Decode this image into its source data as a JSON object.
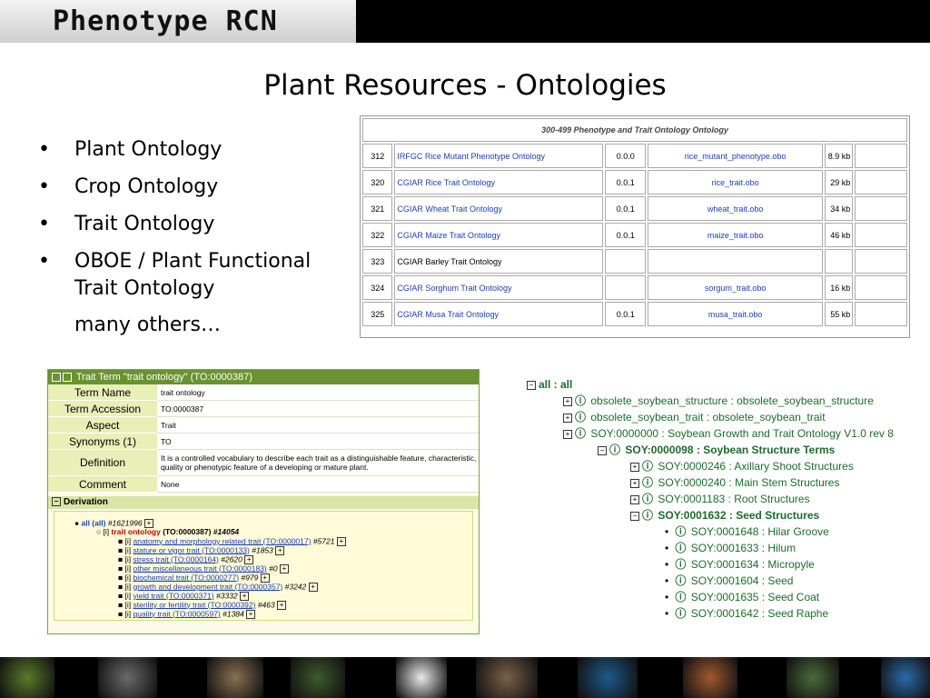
{
  "header": {
    "logo_text": "Phenotype RCN"
  },
  "slide": {
    "title": "Plant Resources - Ontologies",
    "bullets": [
      {
        "marker": "•",
        "text": "Plant Ontology"
      },
      {
        "marker": "•",
        "text": "Crop Ontology"
      },
      {
        "marker": "•",
        "text": "Trait Ontology"
      },
      {
        "marker": "•",
        "text": "OBOE / Plant Functional Trait Ontology"
      }
    ],
    "more": "many others…"
  },
  "ontology_table": {
    "caption": "300-499 Phenotype and Trait Ontology Ontology",
    "rows": [
      {
        "id": "312",
        "name": "IRFGC Rice Mutant Phenotype Ontology",
        "version": "0.0.0",
        "file": "rice_mutant_phenotype.obo",
        "size": "8.9 kb",
        "linked": true
      },
      {
        "id": "320",
        "name": "CGIAR Rice Trait Ontology",
        "version": "0.0.1",
        "file": "rice_trait.obo",
        "size": "29 kb",
        "linked": true
      },
      {
        "id": "321",
        "name": "CGIAR Wheat Trait Ontology",
        "version": "0.0.1",
        "file": "wheat_trait.obo",
        "size": "34 kb",
        "linked": true
      },
      {
        "id": "322",
        "name": "CGIAR Maize Trait Ontology",
        "version": "0.0.1",
        "file": "maize_trait.obo",
        "size": "46 kb",
        "linked": true
      },
      {
        "id": "323",
        "name": "CGIAR Barley Trait Ontology",
        "version": "",
        "file": "",
        "size": "",
        "linked": false
      },
      {
        "id": "324",
        "name": "CGIAR Sorghum Trait Ontology",
        "version": "",
        "file": "sorgum_trait.obo",
        "size": "16 kb",
        "linked": true
      },
      {
        "id": "325",
        "name": "CGIAR Musa Trait Ontology",
        "version": "0.0.1",
        "file": "musa_trait.obo",
        "size": "55 kb",
        "linked": true
      }
    ]
  },
  "trait_panel": {
    "header": "Trait Term \"trait ontology\" (TO:0000387)",
    "fields": [
      {
        "key": "Term Name",
        "value": "trait ontology"
      },
      {
        "key": "Term Accession",
        "value": "TO:0000387"
      },
      {
        "key": "Aspect",
        "value": "Trait"
      },
      {
        "key": "Synonyms (1)",
        "value": "TO"
      },
      {
        "key": "Definition",
        "value": "It is a controlled vocabulary to describe each trait as a distinguishable feature, characteristic, quality or phenotypic feature of a developing or mature plant."
      },
      {
        "key": "Comment",
        "value": "None"
      }
    ],
    "derivation_label": "Derivation",
    "tree_root": {
      "label": "all (all)",
      "count": "#1621996"
    },
    "tree_node": {
      "prefix": "[i]",
      "label": "trait ontology",
      "acc": "(TO:0000387)",
      "count": "#14054"
    },
    "tree_children": [
      {
        "prefix": "[i]",
        "label": "anatomy and morphology related trait (TO:0000017)",
        "count": "#5721"
      },
      {
        "prefix": "[i]",
        "label": "stature or vigor trait (TO:0000133)",
        "count": "#1853"
      },
      {
        "prefix": "[i]",
        "label": "stress trait (TO:0000164)",
        "count": "#2620"
      },
      {
        "prefix": "[i]",
        "label": "other miscellaneous trait (TO:0000183)",
        "count": "#0"
      },
      {
        "prefix": "[i]",
        "label": "biochemical trait (TO:0000277)",
        "count": "#979"
      },
      {
        "prefix": "[i]",
        "label": "growth and development trait (TO:0000357)",
        "count": "#3242"
      },
      {
        "prefix": "[i]",
        "label": "yield trait (TO:0000371)",
        "count": "#3332"
      },
      {
        "prefix": "[i]",
        "label": "sterility or fertility trait (TO:0000392)",
        "count": "#463"
      },
      {
        "prefix": "[i]",
        "label": "quality trait (TO:0000597)",
        "count": "#1384"
      }
    ]
  },
  "soy_tree": {
    "rows": [
      {
        "text": "all : all",
        "toggle": "−",
        "bold": true,
        "info": false
      },
      {
        "text": "obsolete_soybean_structure : obsolete_soybean_structure",
        "toggle": "+",
        "bold": false,
        "info": true
      },
      {
        "text": "obsolete_soybean_trait : obsolete_soybean_trait",
        "toggle": "+",
        "bold": false,
        "info": true
      },
      {
        "text": "SOY:0000000 : Soybean Growth and Trait Ontology V1.0 rev 8",
        "toggle": "+",
        "bold": false,
        "info": true
      },
      {
        "text": "SOY:0000098 : Soybean Structure Terms",
        "toggle": "−",
        "bold": true,
        "info": true
      },
      {
        "text": "SOY:0000246 : Axillary Shoot Structures",
        "toggle": "+",
        "bold": false,
        "info": true
      },
      {
        "text": "SOY:0000240 : Main Stem Structures",
        "toggle": "+",
        "bold": false,
        "info": true
      },
      {
        "text": "SOY:0001183 : Root Structures",
        "toggle": "+",
        "bold": false,
        "info": true
      },
      {
        "text": "SOY:0001632 : Seed Structures",
        "toggle": "−",
        "bold": true,
        "info": true
      },
      {
        "text": "SOY:0001648 : Hilar Groove",
        "toggle": "",
        "bold": false,
        "info": true
      },
      {
        "text": "SOY:0001633 : Hilum",
        "toggle": "",
        "bold": false,
        "info": true
      },
      {
        "text": "SOY:0001634 : Micropyle",
        "toggle": "",
        "bold": false,
        "info": true
      },
      {
        "text": "SOY:0001604 : Seed",
        "toggle": "",
        "bold": false,
        "info": true
      },
      {
        "text": "SOY:0001635 : Seed Coat",
        "toggle": "",
        "bold": false,
        "info": true
      },
      {
        "text": "SOY:0001642 : Seed Raphe",
        "toggle": "",
        "bold": false,
        "info": true
      }
    ]
  },
  "footer": {
    "photos": [
      "rice-plant-photo",
      "mouse-photo",
      "leaf-fossil-photo",
      "insect-closeup-photo",
      "white-flower-photo",
      "stick-insect-photo",
      "zebrafish-photo",
      "corn-ears-photo",
      "ant-photo",
      "butterfly-photo"
    ]
  },
  "colors": {
    "tree_green": "#1d6b2a",
    "panel_green": "#6a9230",
    "link_blue": "#1a3fb8"
  }
}
